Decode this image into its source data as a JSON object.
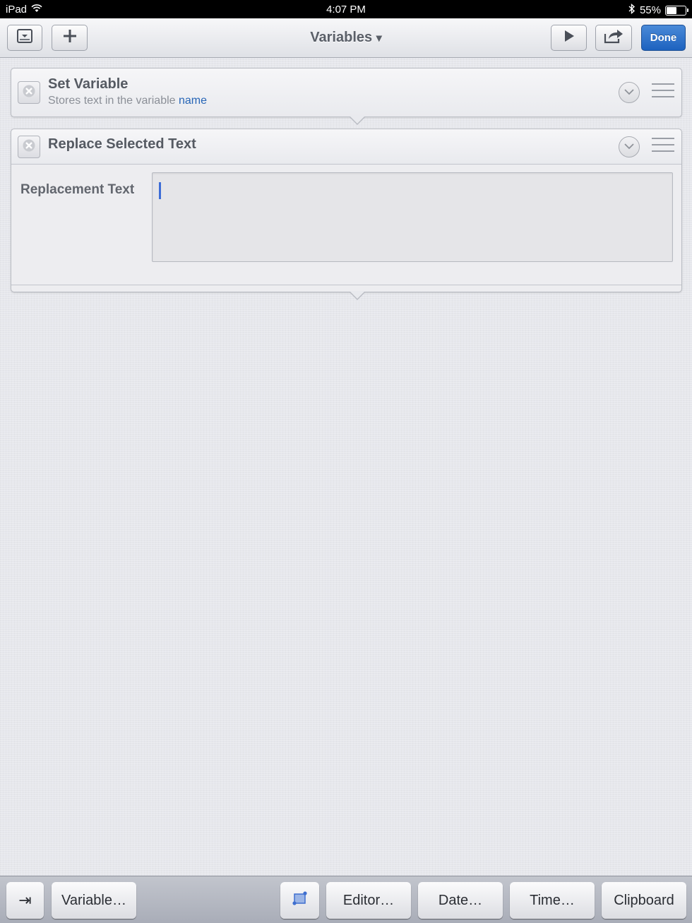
{
  "status_bar": {
    "device": "iPad",
    "time": "4:07 PM",
    "battery_percent": "55%",
    "battery_level": 0.55,
    "icons": [
      "wifi-icon",
      "bluetooth-icon",
      "battery-icon"
    ]
  },
  "toolbar": {
    "title": "Variables",
    "title_menu_glyph": "▾",
    "left_buttons": [
      "collapse-icon",
      "plus-icon"
    ],
    "right_buttons": [
      "play-icon",
      "share-icon"
    ],
    "done_label": "Done"
  },
  "actions": [
    {
      "title": "Set Variable",
      "subtitle_prefix": "Stores text in the variable",
      "subtitle_variable": "name",
      "expanded": false
    },
    {
      "title": "Replace Selected Text",
      "expanded": true,
      "parameter_label": "Replacement Text",
      "parameter_value": ""
    }
  ],
  "accessory_bar": {
    "tab_glyph": "⇥",
    "variable_label": "Variable…",
    "editor_label": "Editor…",
    "date_label": "Date…",
    "time_label": "Time…",
    "clipboard_label": "Clipboard"
  },
  "colors": {
    "accent": "#1d62bf",
    "variable_link": "#2765b6",
    "caret": "#3d6dd6"
  }
}
